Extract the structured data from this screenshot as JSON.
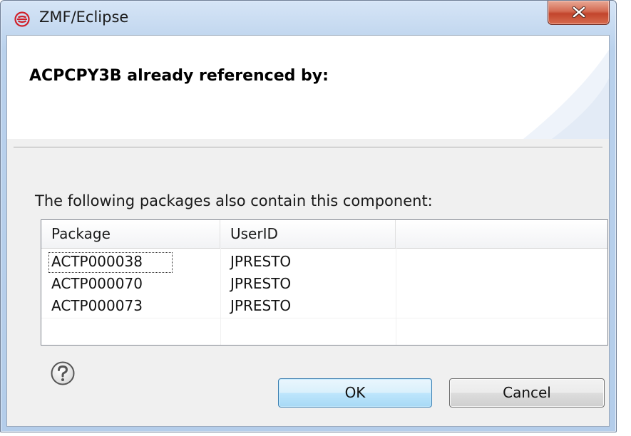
{
  "window": {
    "title": "ZMF/Eclipse",
    "close_symbol": "X"
  },
  "header": {
    "title": "ACPCPY3B already referenced by:"
  },
  "body": {
    "message": "The following packages also contain this component:"
  },
  "table": {
    "columns": [
      "Package",
      "UserID",
      ""
    ],
    "rows": [
      {
        "package": "ACTP000038",
        "userid": "JPRESTO"
      },
      {
        "package": "ACTP000070",
        "userid": "JPRESTO"
      },
      {
        "package": "ACTP000073",
        "userid": "JPRESTO"
      }
    ],
    "selected_row": 0
  },
  "buttons": {
    "ok": "OK",
    "cancel": "Cancel"
  },
  "icons": {
    "app": "serena-logo-icon",
    "help": "help-icon",
    "close": "close-icon"
  },
  "colors": {
    "close_button": "#c8492f",
    "ok_border": "#3c7fb1",
    "app_logo": "#d0202a"
  }
}
